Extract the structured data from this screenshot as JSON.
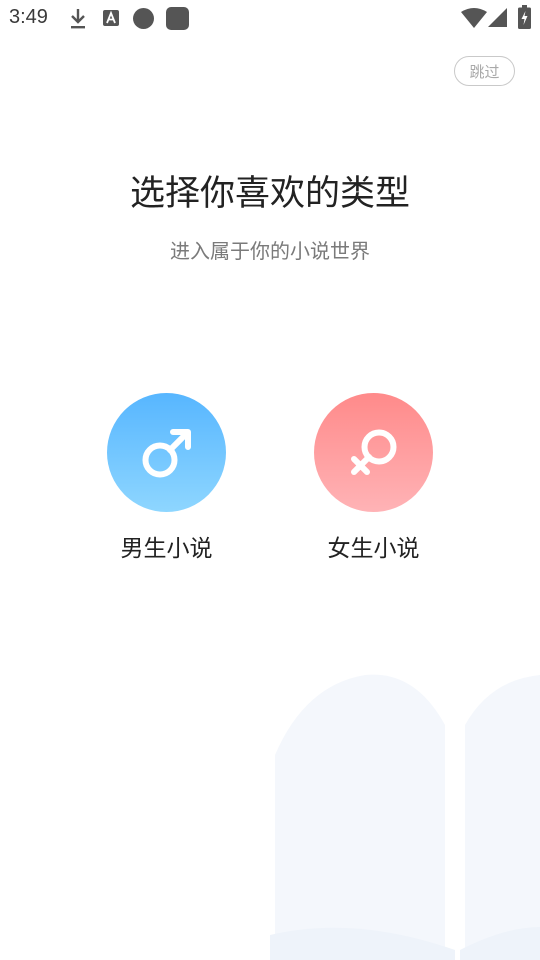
{
  "status_bar": {
    "time": "3:49",
    "left_icons": [
      "download-icon",
      "a-box-icon",
      "circle-icon",
      "square-icon"
    ],
    "right_icons": [
      "wifi-icon",
      "signal-icon",
      "battery-icon"
    ]
  },
  "skip_label": "跳过",
  "title": "选择你喜欢的类型",
  "subtitle": "进入属于你的小说世界",
  "choices": [
    {
      "label": "男生小说",
      "icon": "male-symbol-icon",
      "color_top": "#57b6ff",
      "color_bottom": "#8ed6ff"
    },
    {
      "label": "女生小说",
      "icon": "female-symbol-icon",
      "color_top": "#ff8a8a",
      "color_bottom": "#ffb3b6"
    }
  ]
}
